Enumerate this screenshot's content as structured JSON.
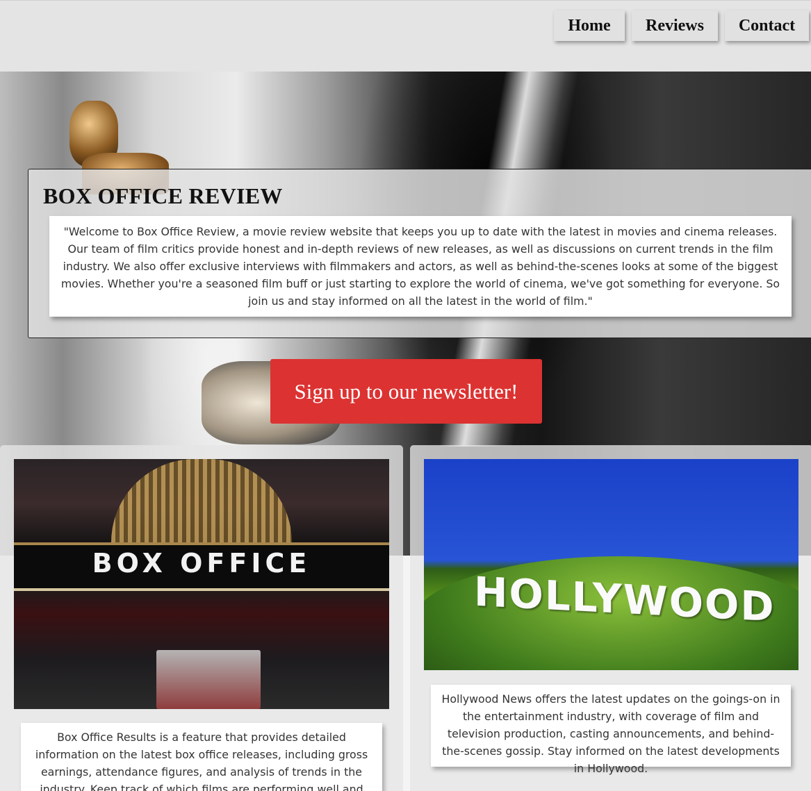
{
  "nav": {
    "home": "Home",
    "reviews": "Reviews",
    "contact": "Contact"
  },
  "hero": {
    "title": "BOX OFFICE REVIEW",
    "intro": "\"Welcome to Box Office Review, a movie review website that keeps you up to date with the latest in movies and cinema releases. Our team of film critics provide honest and in-depth reviews of new releases, as well as discussions on current trends in the film industry. We also offer exclusive interviews with filmmakers and actors, as well as behind-the-scenes looks at some of the biggest movies. Whether you're a seasoned film buff or just starting to explore the world of cinema, we've got something for everyone. So join us and stay informed on all the latest in the world of film.\"",
    "cta": "Sign up to our newsletter!"
  },
  "cards": [
    {
      "image_text": "BOX OFFICE",
      "text": "Box Office Results is a feature that provides detailed information on the latest box office releases, including gross earnings, attendance figures, and analysis of trends in the industry. Keep track of which films are performing well and"
    },
    {
      "image_text": "HOLLYWOOD",
      "text": "Hollywood News offers the latest updates on the goings-on in the entertainment industry, with coverage of film and television production, casting announcements, and behind-the-scenes gossip. Stay informed on the latest developments in Hollywood."
    }
  ],
  "colors": {
    "cta": "#dc3232",
    "navbar": "#e4e4e4"
  }
}
